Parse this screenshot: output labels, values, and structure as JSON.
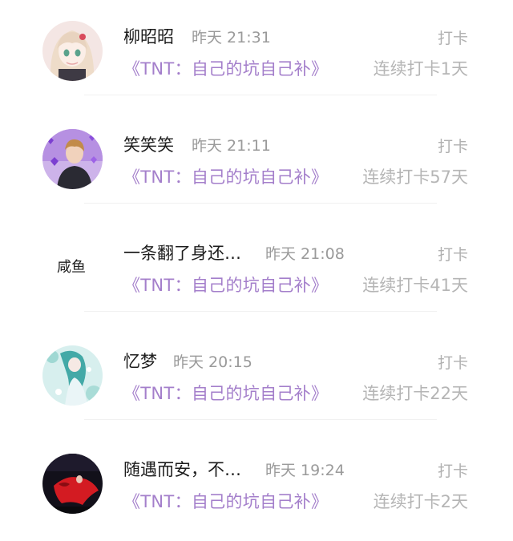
{
  "checkins": [
    {
      "name": "柳昭昭",
      "time": "昨天 21:31",
      "action": "打卡",
      "book": "《TNT：自己的坑自己补》",
      "streak": "连续打卡1天",
      "avatar_icon": "anime-girl-avatar-icon"
    },
    {
      "name": "笑笑笑",
      "time": "昨天 21:11",
      "action": "打卡",
      "book": "《TNT：自己的坑自己补》",
      "streak": "连续打卡57天",
      "avatar_icon": "boy-purple-hearts-avatar-icon"
    },
    {
      "name": "一条翻了身还…",
      "time": "昨天 21:08",
      "action": "打卡",
      "book": "《TNT：自己的坑自己补》",
      "streak": "连续打卡41天",
      "avatar_icon": "salted-fish-avatar-icon",
      "avatar_text": "咸鱼"
    },
    {
      "name": "忆梦",
      "time": "昨天 20:15",
      "action": "打卡",
      "book": "《TNT：自己的坑自己补》",
      "streak": "连续打卡22天",
      "avatar_icon": "teal-anime-girl-avatar-icon"
    },
    {
      "name": "随遇而安，不…",
      "time": "昨天 19:24",
      "action": "打卡",
      "book": "《TNT：自己的坑自己补》",
      "streak": "连续打卡2天",
      "avatar_icon": "red-dress-dark-avatar-icon"
    }
  ],
  "colors": {
    "book_link": "#a47fcb",
    "name": "#1c1c1c",
    "meta": "#9a9a9a"
  }
}
